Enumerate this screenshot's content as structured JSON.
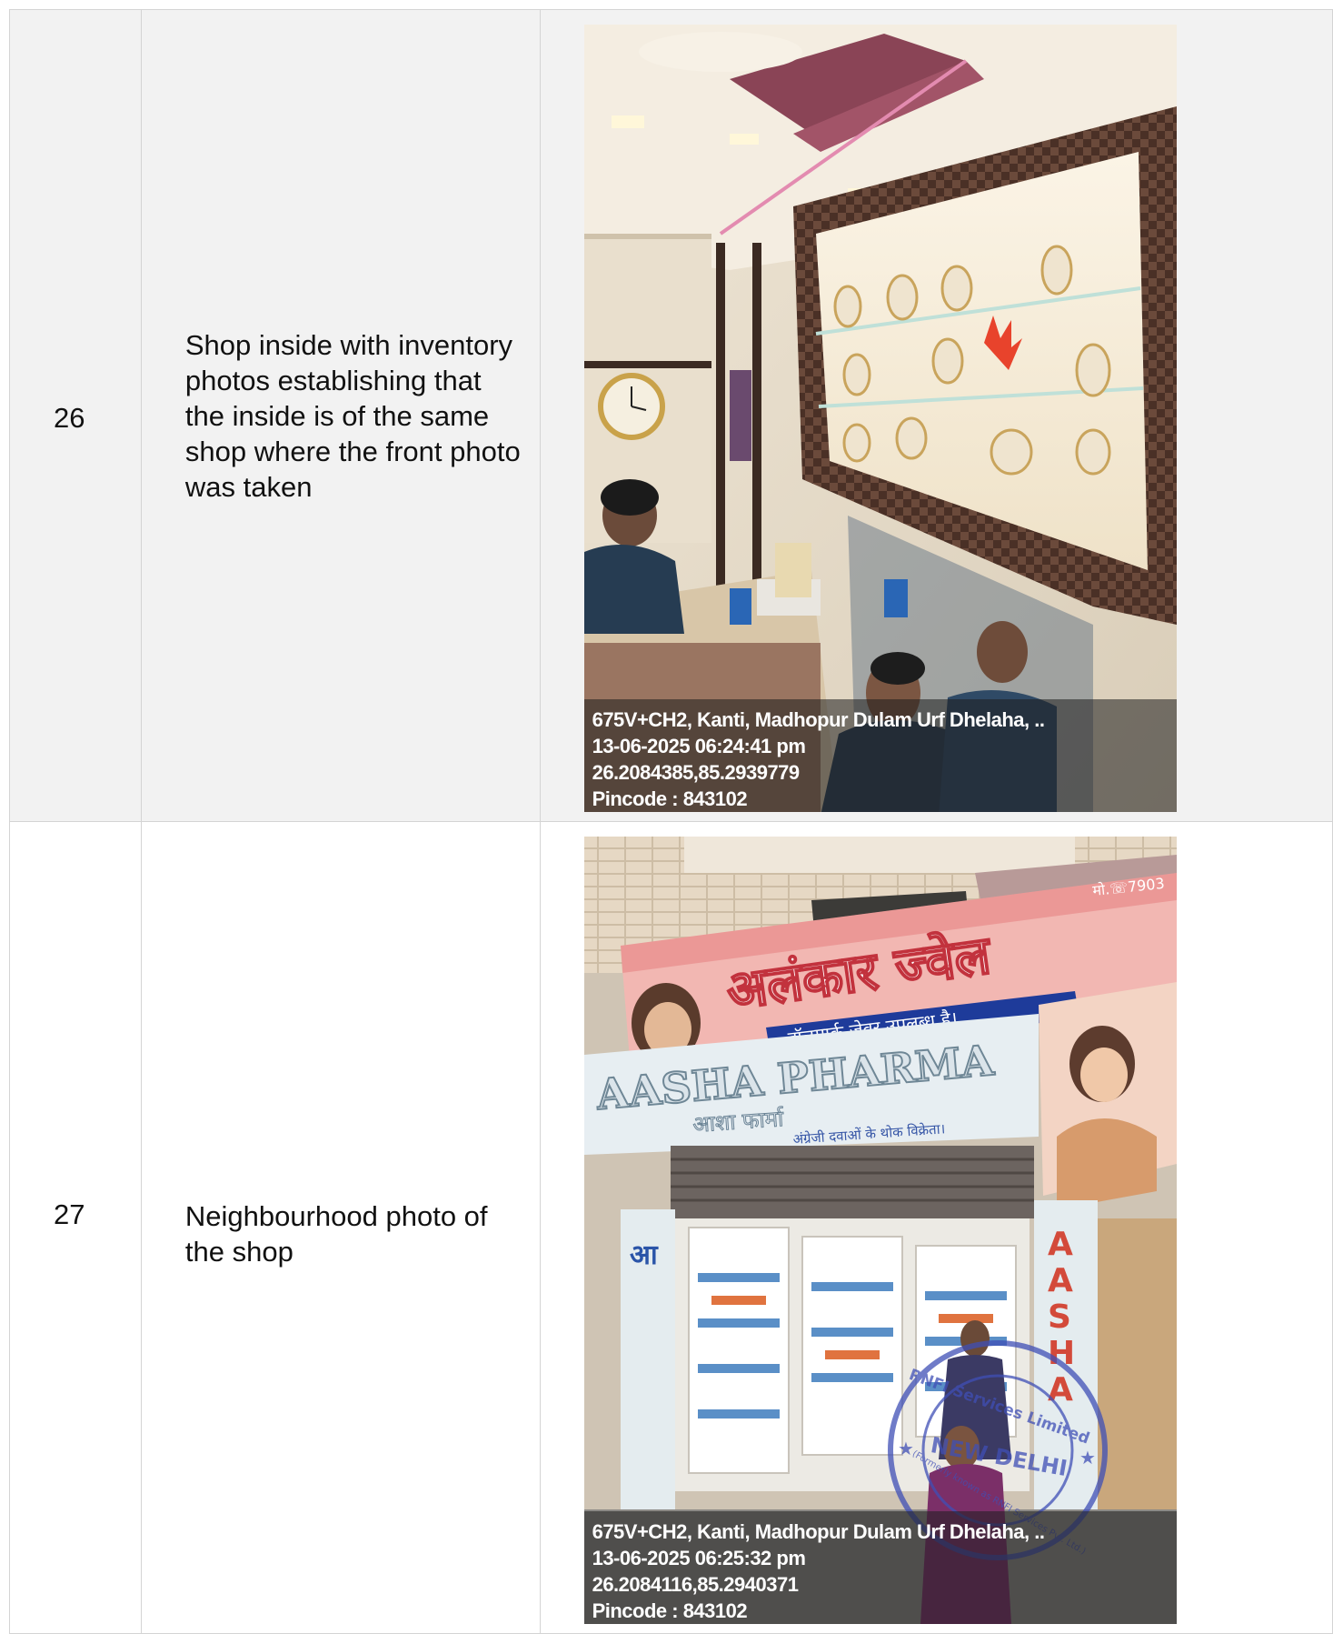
{
  "rows": [
    {
      "number": "26",
      "description": "Shop inside with inventory photos establishing that the inside is of the same shop where the front photo was taken",
      "geo": {
        "address": "675V+CH2, Kanti, Madhopur Dulam Urf Dhelaha, ..",
        "datetime": "13-06-2025 06:24:41 pm",
        "coords": "26.2084385,85.2939779",
        "pincode": "Pincode : 843102"
      }
    },
    {
      "number": "27",
      "description": "Neighbourhood photo of the shop",
      "geo": {
        "address": "675V+CH2, Kanti, Madhopur Dulam Urf Dhelaha, ..",
        "datetime": "13-06-2025 06:25:32 pm",
        "coords": "26.2084116,85.2940371",
        "pincode": "Pincode : 843102"
      },
      "signage": {
        "shop_hindi": "अलंकार ज्वेल",
        "hallmark": "हॉलमार्क जेवर उपलब्ध है।",
        "pharma": "AASHA PHARMA",
        "pharma_hindi": "आशा फार्मा",
        "pharma_sub": "अंग्रेजी दवाओं के थोक विक्रेता।",
        "mobile": "मो.☏7903",
        "side_sign": "AASHA",
        "stamp_top": "RNFI Services Limited",
        "stamp_mid": "NEW DELHI",
        "stamp_bottom": "(Formerly known as RNFI Services Pvt. Ltd.)"
      }
    }
  ]
}
